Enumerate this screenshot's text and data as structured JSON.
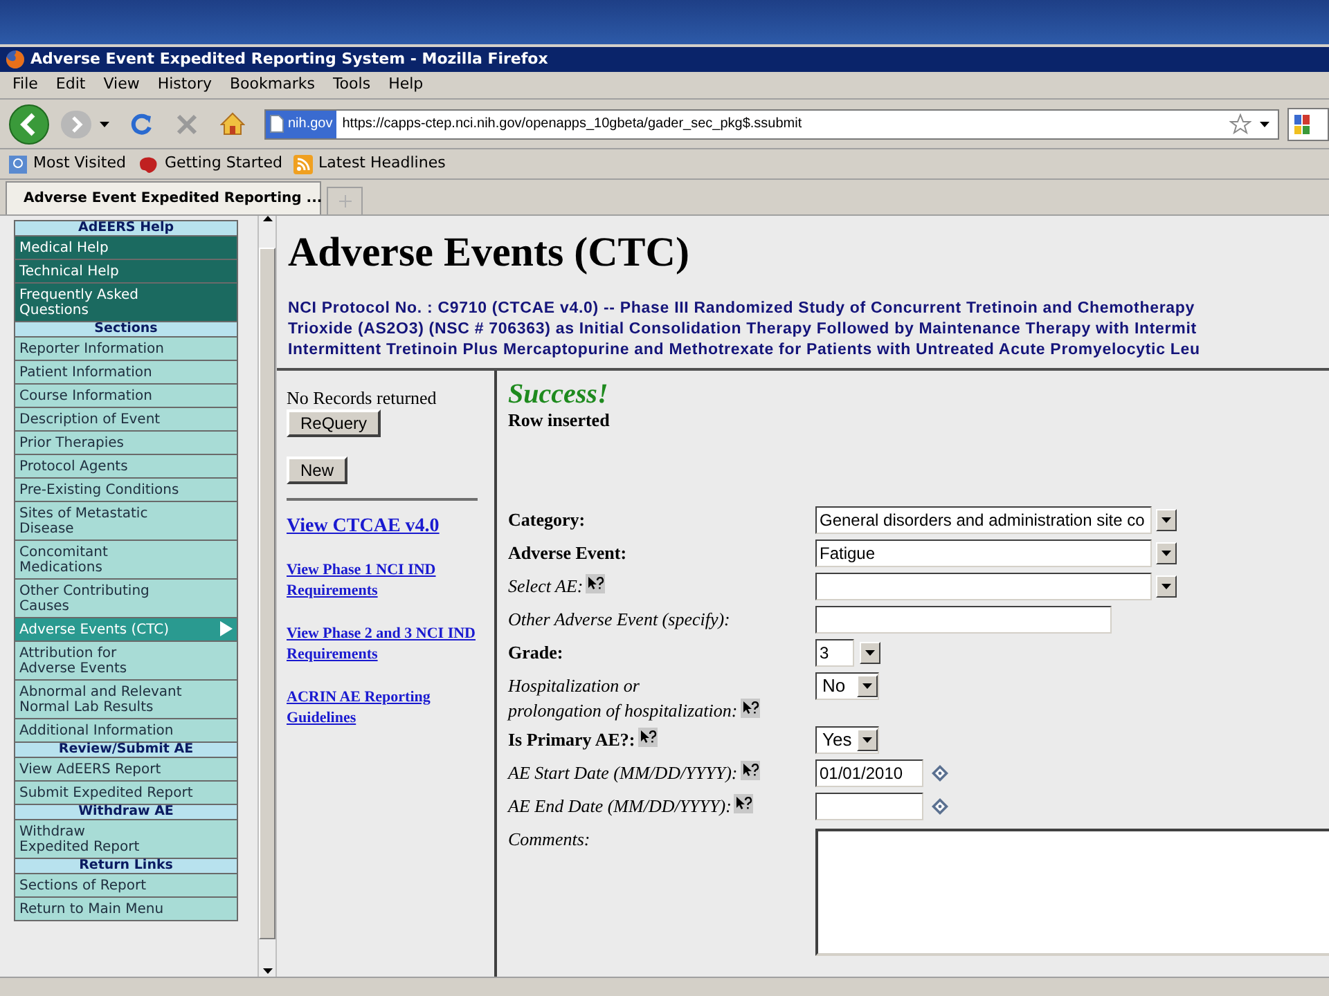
{
  "window": {
    "title": "Adverse Event Expedited Reporting System - Mozilla Firefox"
  },
  "menu": [
    "File",
    "Edit",
    "View",
    "History",
    "Bookmarks",
    "Tools",
    "Help"
  ],
  "address": {
    "site": "nih.gov",
    "url": "https://capps-ctep.nci.nih.gov/openapps_10gbeta/gader_sec_pkg$.ssubmit"
  },
  "bookmarks": [
    {
      "label": "Most Visited",
      "kind": "search"
    },
    {
      "label": "Getting Started",
      "kind": "start"
    },
    {
      "label": "Latest Headlines",
      "kind": "feed"
    }
  ],
  "tabs": [
    {
      "label": "Adverse Event Expedited Reporting ...",
      "selected": true
    }
  ],
  "sidebar": [
    {
      "header": "AdEERS Help",
      "items": [
        {
          "lines": [
            "Medical Help"
          ],
          "kind": "help",
          "selected": false
        },
        {
          "lines": [
            "Technical Help"
          ],
          "kind": "help",
          "selected": false
        },
        {
          "lines": [
            "Frequently Asked",
            "Questions"
          ],
          "kind": "help",
          "selected": false
        }
      ]
    },
    {
      "header": "Sections",
      "items": [
        {
          "lines": [
            "Reporter Information"
          ],
          "kind": "link",
          "selected": false
        },
        {
          "lines": [
            "Patient Information"
          ],
          "kind": "link",
          "selected": false
        },
        {
          "lines": [
            "Course Information"
          ],
          "kind": "link",
          "selected": false
        },
        {
          "lines": [
            "Description of Event"
          ],
          "kind": "link",
          "selected": false
        },
        {
          "lines": [
            "Prior Therapies"
          ],
          "kind": "link",
          "selected": false
        },
        {
          "lines": [
            "Protocol Agents"
          ],
          "kind": "link",
          "selected": false
        },
        {
          "lines": [
            "Pre-Existing Conditions"
          ],
          "kind": "link",
          "selected": false
        },
        {
          "lines": [
            "Sites of Metastatic",
            "Disease"
          ],
          "kind": "link",
          "selected": false
        },
        {
          "lines": [
            "Concomitant",
            "Medications"
          ],
          "kind": "link",
          "selected": false
        },
        {
          "lines": [
            "Other Contributing",
            "Causes"
          ],
          "kind": "link",
          "selected": false
        },
        {
          "lines": [
            "Adverse Events (CTC)"
          ],
          "kind": "link",
          "selected": true
        },
        {
          "lines": [
            "Attribution for",
            "Adverse Events"
          ],
          "kind": "link",
          "selected": false
        },
        {
          "lines": [
            "Abnormal and Relevant",
            "Normal Lab Results"
          ],
          "kind": "link",
          "selected": false
        },
        {
          "lines": [
            "Additional Information"
          ],
          "kind": "link",
          "selected": false
        }
      ]
    },
    {
      "header": "Review/Submit AE",
      "items": [
        {
          "lines": [
            "View AdEERS Report"
          ],
          "kind": "link",
          "selected": false
        },
        {
          "lines": [
            "Submit Expedited Report"
          ],
          "kind": "link",
          "selected": false
        }
      ]
    },
    {
      "header": "Withdraw AE",
      "items": [
        {
          "lines": [
            "Withdraw",
            "Expedited Report"
          ],
          "kind": "link",
          "selected": false
        }
      ]
    },
    {
      "header": "Return Links",
      "items": [
        {
          "lines": [
            "Sections of Report"
          ],
          "kind": "link",
          "selected": false
        },
        {
          "lines": [
            "Return to Main Menu"
          ],
          "kind": "link",
          "selected": false
        }
      ]
    }
  ],
  "page": {
    "title": "Adverse Events (CTC)",
    "protocol_lines": [
      "NCI Protocol No. : C9710 (CTCAE v4.0) -- Phase III Randomized Study of Concurrent Tretinoin and Chemotherapy",
      "Trioxide (AS2O3) (NSC # 706363) as Initial Consolidation Therapy Followed by Maintenance Therapy with Intermit",
      "Intermittent Tretinoin Plus Mercaptopurine and Methotrexate for Patients with Untreated Acute Promyelocytic Leu"
    ]
  },
  "query": {
    "status": "No Records returned",
    "buttons": [
      "ReQuery",
      "New"
    ],
    "links": [
      {
        "label": "View CTCAE v4.0",
        "kind": "large"
      },
      {
        "label": "View Phase 1 NCI IND Requirements",
        "kind": "small"
      },
      {
        "label": "View Phase 2 and 3 NCI IND Requirements",
        "kind": "small"
      },
      {
        "label": "ACRIN AE Reporting Guidelines",
        "kind": "small"
      }
    ]
  },
  "result": {
    "title": "Success!",
    "message": "Row inserted"
  },
  "form": [
    {
      "label_lines": [
        "Category:"
      ],
      "required": true,
      "help": false,
      "kind": "select",
      "value": "General disorders and administration site co"
    },
    {
      "label_lines": [
        "Adverse Event:"
      ],
      "required": true,
      "help": false,
      "kind": "select",
      "value": "Fatigue"
    },
    {
      "label_lines": [
        "Select AE:"
      ],
      "required": false,
      "help": true,
      "kind": "select"
    },
    {
      "label_lines": [
        "Other Adverse Event (specify):"
      ],
      "required": false,
      "help": false,
      "kind": "text"
    },
    {
      "label_lines": [
        "Grade:"
      ],
      "required": true,
      "help": false,
      "kind": "combo",
      "value": "3"
    },
    {
      "label_lines": [
        "Hospitalization or",
        "prolongation of hospitalization:"
      ],
      "required": false,
      "help": true,
      "kind": "small-select",
      "value": "No"
    },
    {
      "label_lines": [
        "Is Primary AE?:"
      ],
      "required": true,
      "help": true,
      "kind": "small-select",
      "value": "Yes"
    },
    {
      "label_lines": [
        "AE Start Date (MM/DD/YYYY):"
      ],
      "required": false,
      "help": true,
      "kind": "date",
      "value": "01/01/2010"
    },
    {
      "label_lines": [
        "AE End Date (MM/DD/YYYY):"
      ],
      "required": false,
      "help": true,
      "kind": "date"
    },
    {
      "label_lines": [
        "Comments:"
      ],
      "required": false,
      "help": false,
      "kind": "textarea"
    }
  ]
}
